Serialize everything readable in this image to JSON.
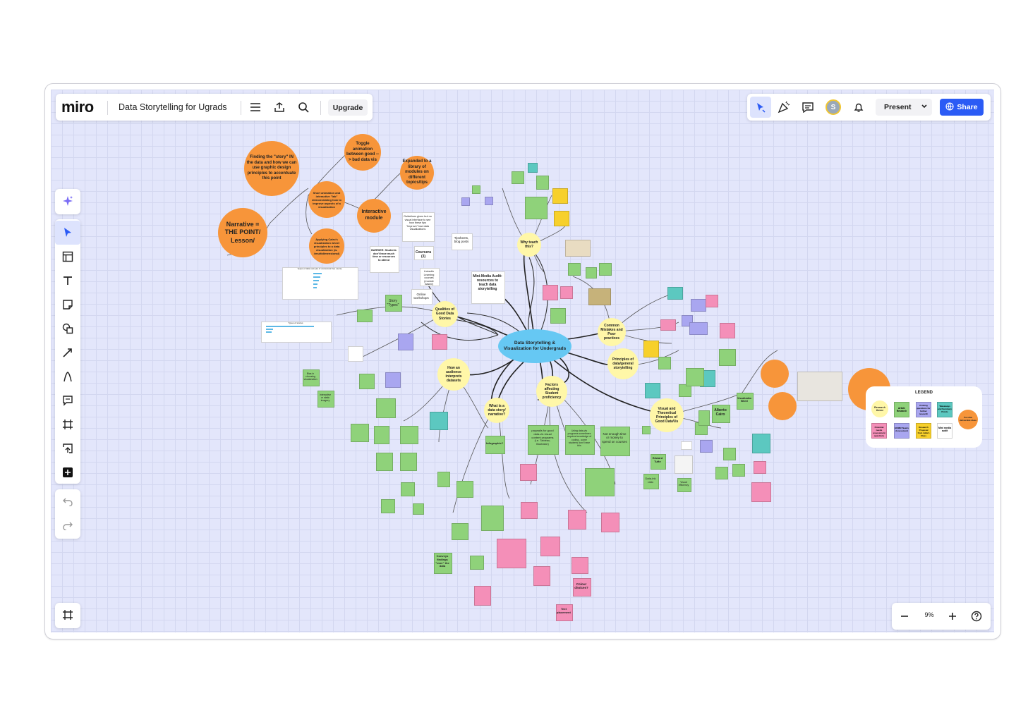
{
  "board": {
    "app_name": "miro",
    "title": "Data Storytelling for Ugrads",
    "upgrade_label": "Upgrade",
    "present_label": "Present",
    "share_label": "Share",
    "avatar_initial": "S",
    "zoom_level": "9%"
  },
  "left_toolbar": {
    "tools": [
      "sparkle-icon",
      "select-icon",
      "templates-icon",
      "text-icon",
      "sticky-note-icon",
      "shapes-icon",
      "connector-icon",
      "pen-icon",
      "comment-icon",
      "frame-icon",
      "upload-icon",
      "add-icon"
    ]
  },
  "mindmap": {
    "center": "Data Storytelling & Visualization for Undergrads",
    "themes": [
      "Why teach this?",
      "Mini-Media Audit: resources to teach data storytelling",
      "Qualities of Good Data Stories",
      "How an audience interprets datasets",
      "What is a data story/ narrative?",
      "Factors affecting Student proficiency",
      "Principles of data/general storytelling",
      "Common Mistakes and Poor practices",
      "Visual and Theoretical Principles of Good DataVis"
    ],
    "orange": [
      "Finding the \"story\" IN the data and how we can use graphic design principles to accentuate this point",
      "Narrative = THE POINT/ Lesson/",
      "Toggle animation between good --> bad data vis",
      "Expanded to a library of modules on different topics/tips",
      "Interactive module",
      "Short animation and interactive \"lab\" demonstrating how to improve aspects of a visualization",
      "Applying Cairo's visualization wheel principles to a data visualization (w. #multidimensional)"
    ],
    "notes": {
      "coursera": "Coursera (3)",
      "tipsheets": "Tipsheets, blog posts",
      "guidelines": "Guidelines given but no visual interface to see how these tips \"improve\" bad data visualizations",
      "barrier": "BARRIER: Students don't have much time or resources to attend",
      "online": "Online workshops",
      "linkedin": "LinkedIn Learning courses (module based)",
      "story_types": "Story \"Types\"",
      "infographic": "Infographic?",
      "alberto": "Alberto Cairo",
      "edward": "Edward Tufte",
      "viz_wheel": "Visualization Wheel",
      "paywalls": "paywalls for good data-vis visual content programs (i.e. Tableau, Illustrator)",
      "dataviz_programs": "Using data-vis programs sometimes requires knowledge of coding - some students don't have this",
      "not_enough_time": "Not enough time or money to spend on courses",
      "colour": "Colour choices?",
      "text_placement": "Text placement?",
      "conveys": "Conveys findings \"over\" the data",
      "data_ink": "Data-ink ratio",
      "visual_efficiency": "Visual efficiency",
      "bias": "Bias in choosing visualization",
      "interactive_static": "Interactive or static imagery"
    },
    "chart_thumbs": {
      "chart1_title": "Types of data sets (as of occasional free users)",
      "chart2_title": "Types of stories"
    }
  },
  "legend": {
    "title": "LEGEND",
    "items": [
      "Research theme",
      "Article Research",
      "Probing questions for further research",
      "Takeaways and Summary Points",
      "Potential needs assessment questions",
      "HOME! Needs Assessment",
      "Research Proposal from Julia's Class",
      "Mini media audit",
      "Possible deliverable ideas"
    ]
  },
  "colors": {
    "canvas": "#e3e6fb",
    "orange": "#f7953a",
    "yellow": "#fff7a8",
    "blue": "#66c8f3",
    "green": "#8fd27a",
    "pink": "#f48fb8",
    "teal": "#5cc8c0",
    "purple": "#a9a6f0",
    "yellow_sticky": "#f7d02c",
    "share_blue": "#2b5bf5"
  }
}
